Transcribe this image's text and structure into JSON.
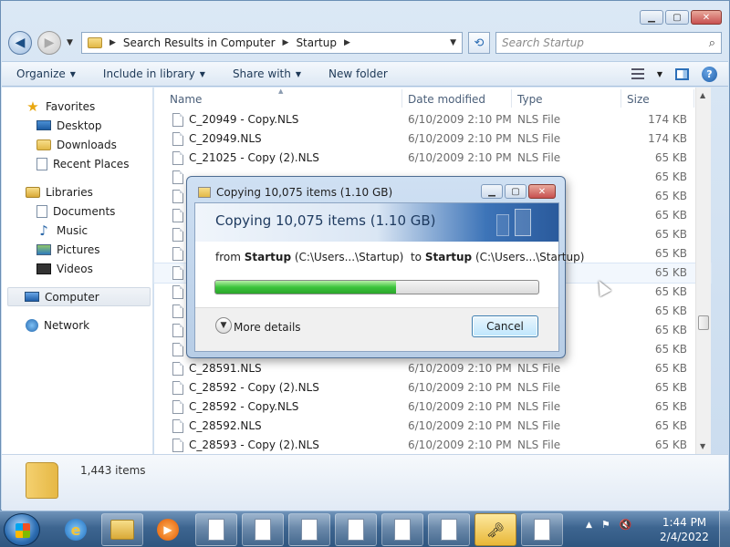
{
  "window": {
    "caption_buttons": [
      "minimize",
      "maximize",
      "close"
    ]
  },
  "address": {
    "crumbs": [
      "Search Results in Computer",
      "Startup"
    ],
    "search_placeholder": "Search Startup"
  },
  "toolbar": {
    "organize": "Organize",
    "include_in_library": "Include in library",
    "share_with": "Share with",
    "new_folder": "New folder"
  },
  "nav": {
    "favorites": "Favorites",
    "desktop": "Desktop",
    "downloads": "Downloads",
    "recent_places": "Recent Places",
    "libraries": "Libraries",
    "documents": "Documents",
    "music": "Music",
    "pictures": "Pictures",
    "videos": "Videos",
    "computer": "Computer",
    "network": "Network"
  },
  "columns": {
    "name": "Name",
    "date_modified": "Date modified",
    "type": "Type",
    "size": "Size"
  },
  "files": [
    {
      "name": "C_20949 - Copy.NLS",
      "date": "6/10/2009 2:10 PM",
      "type": "NLS File",
      "size": "174 KB"
    },
    {
      "name": "C_20949.NLS",
      "date": "6/10/2009 2:10 PM",
      "type": "NLS File",
      "size": "174 KB"
    },
    {
      "name": "C_21025 - Copy (2).NLS",
      "date": "6/10/2009 2:10 PM",
      "type": "NLS File",
      "size": "65 KB"
    },
    {
      "name": "",
      "date": "",
      "type": "",
      "size": "65 KB"
    },
    {
      "name": "",
      "date": "",
      "type": "",
      "size": "65 KB"
    },
    {
      "name": "",
      "date": "",
      "type": "",
      "size": "65 KB"
    },
    {
      "name": "",
      "date": "",
      "type": "",
      "size": "65 KB"
    },
    {
      "name": "",
      "date": "",
      "type": "",
      "size": "65 KB"
    },
    {
      "name": "",
      "date": "",
      "type": "",
      "size": "65 KB"
    },
    {
      "name": "",
      "date": "",
      "type": "",
      "size": "65 KB"
    },
    {
      "name": "",
      "date": "",
      "type": "",
      "size": "65 KB"
    },
    {
      "name": "",
      "date": "",
      "type": "",
      "size": "65 KB"
    },
    {
      "name": "",
      "date": "",
      "type": "",
      "size": "65 KB"
    },
    {
      "name": "C_28591.NLS",
      "date": "6/10/2009 2:10 PM",
      "type": "NLS File",
      "size": "65 KB"
    },
    {
      "name": "C_28592 - Copy (2).NLS",
      "date": "6/10/2009 2:10 PM",
      "type": "NLS File",
      "size": "65 KB"
    },
    {
      "name": "C_28592 - Copy.NLS",
      "date": "6/10/2009 2:10 PM",
      "type": "NLS File",
      "size": "65 KB"
    },
    {
      "name": "C_28592.NLS",
      "date": "6/10/2009 2:10 PM",
      "type": "NLS File",
      "size": "65 KB"
    },
    {
      "name": "C_28593 - Copy (2).NLS",
      "date": "6/10/2009 2:10 PM",
      "type": "NLS File",
      "size": "65 KB"
    }
  ],
  "details": {
    "item_count": "1,443 items"
  },
  "dialog": {
    "title": "Copying 10,075 items (1.10 GB)",
    "heading": "Copying 10,075 items (1.10 GB)",
    "from_label": "from",
    "from_name": "Startup",
    "from_path": "(C:\\Users...\\Startup)",
    "to_label": "to",
    "to_name": "Startup",
    "to_path": "(C:\\Users...\\Startup)",
    "progress_percent": 56,
    "more_details": "More details",
    "cancel": "Cancel"
  },
  "taskbar": {
    "time": "1:44 PM",
    "date": "2/4/2022",
    "icons": [
      "start-orb",
      "internet-explorer",
      "windows-explorer",
      "media-player",
      "document",
      "document",
      "document",
      "document",
      "document",
      "document",
      "key-utility",
      "document"
    ]
  },
  "colors": {
    "progress_fill": "#3cc43c",
    "close_button": "#c75050",
    "taskbar": "#3d6590"
  }
}
